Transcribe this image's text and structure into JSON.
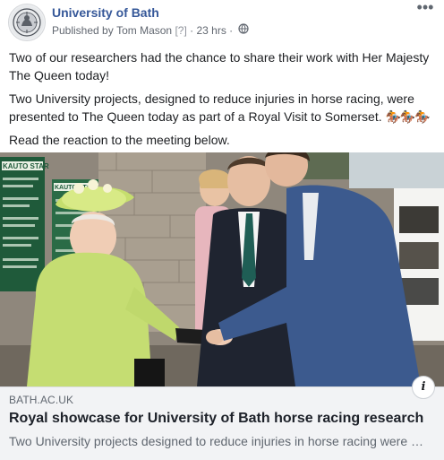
{
  "header": {
    "page_name": "University of Bath",
    "published_prefix": "Published by",
    "publisher": "Tom Mason",
    "tip_marker": "[?]",
    "dot": "·",
    "time_ago": "23 hrs",
    "dot2": "·",
    "privacy_icon": "globe-icon",
    "more_icon": "more-options-icon",
    "more_glyph": "•••"
  },
  "post": {
    "paragraphs": [
      "Two of our researchers had the chance to share their work with Her Majesty The Queen today!",
      "Two University projects, designed to reduce injuries in horse racing, were presented to The Queen today as part of a Royal Visit to Somerset.",
      "Read the reaction to the meeting below."
    ],
    "emoji": "🏇🏇🏇"
  },
  "photo": {
    "signs": [
      "KAUTO STAR",
      "KAUTO STAR",
      "KAUTO STAR"
    ]
  },
  "link_card": {
    "info_glyph": "i",
    "domain": "BATH.AC.UK",
    "title": "Royal showcase for University of Bath horse racing research",
    "description": "Two University projects designed to reduce injuries in horse racing were presented to The Queen today as part of a Royal Visit to Somerset."
  },
  "colors": {
    "link_blue": "#365899",
    "meta_gray": "#616770",
    "card_bg": "#f2f3f5"
  }
}
